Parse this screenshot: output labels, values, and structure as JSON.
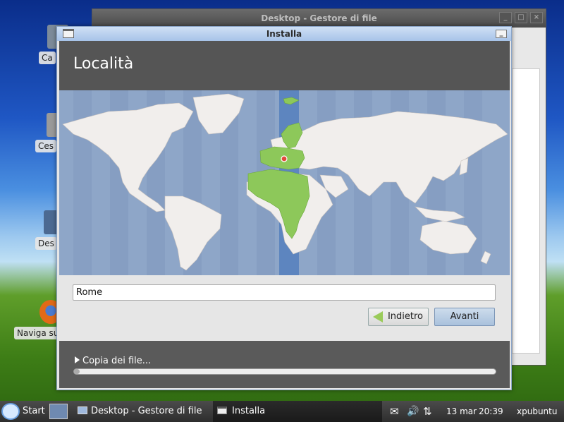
{
  "desktop": {
    "icons": [
      {
        "label": "Ca"
      },
      {
        "label": "Ces"
      },
      {
        "label": "Des"
      },
      {
        "label": "Naviga su"
      }
    ]
  },
  "bg_window": {
    "title": "Desktop - Gestore di file"
  },
  "install_window": {
    "title": "Installa",
    "header": "Località",
    "city_value": "Rome",
    "back_label": "Indietro",
    "next_label": "Avanti",
    "footer_text": "Copia dei file...",
    "progress": 0.0
  },
  "taskbar": {
    "start_label": "Start",
    "task1": "Desktop - Gestore di file",
    "task2": "Installa",
    "date": "13 mar",
    "time": "20:39",
    "user": "xpubuntu"
  }
}
